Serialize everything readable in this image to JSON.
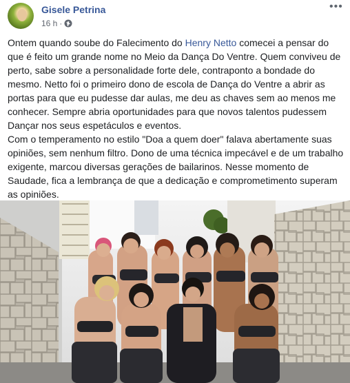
{
  "post": {
    "author": "Gisele Petrina",
    "timestamp": "16 h",
    "separator": "·",
    "paragraph1": {
      "before": "Ontem quando soube do Falecimento do ",
      "mention": "Henry Netto",
      "after": " comecei a pensar do que é feito um grande nome no Meio da Dança Do Ventre. Quem conviveu de perto, sabe sobre a personalidade forte dele, contraponto a bondade do mesmo. Netto foi o primeiro dono de escola de Dança do Ventre a abrir as portas para que eu pudesse dar aulas, me deu as chaves sem ao menos me conhecer. Sempre abria oportunidades para que novos talentos pudessem Dançar nos seus espetáculos e eventos."
    },
    "paragraph2": "Com o temperamento no estilo \"Doa a quem doer\" falava abertamente suas opiniões, sem nenhum filtro. Dono de uma técnica impecável e de um trabalho exigente, marcou diversas gerações de bailarinos. Nesse momento de Saudade, fica a lembrança de que a dedicação e comprometimento superam as opiniões."
  },
  "icons": {
    "privacy": "globe-icon",
    "options": "more-options-icon"
  },
  "colors": {
    "link": "#385898",
    "text": "#1c1e21",
    "meta": "#616770"
  }
}
